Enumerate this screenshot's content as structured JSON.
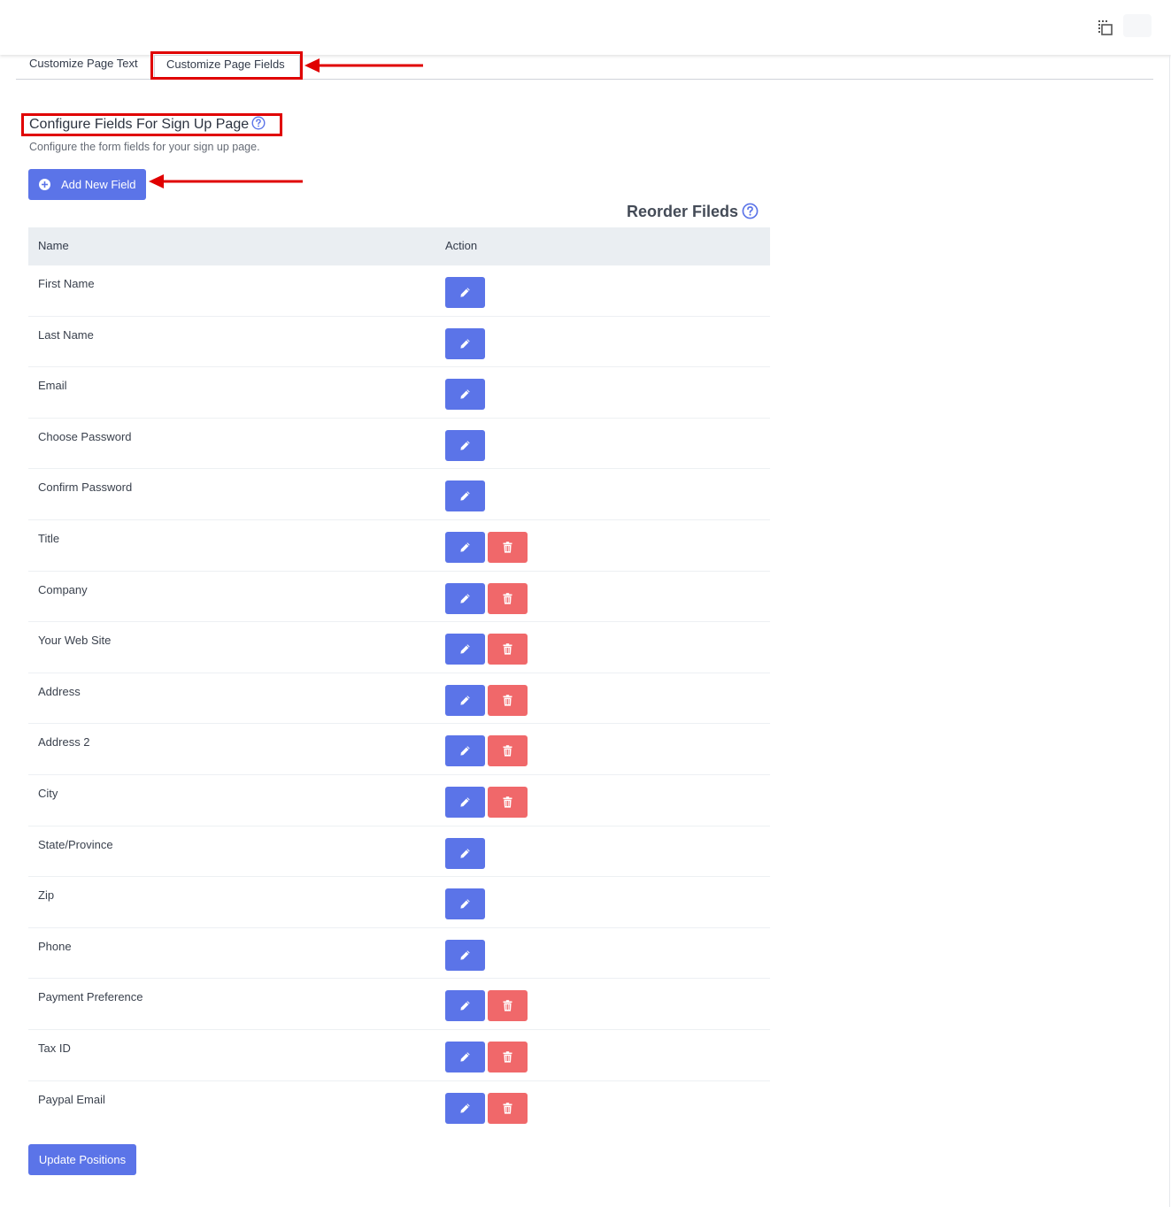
{
  "header": {
    "tool_icon": "selection-copy-icon",
    "avatar_icon": "avatar"
  },
  "tabs": [
    {
      "label": "Customize Page Text",
      "active": false
    },
    {
      "label": "Customize Page Fields",
      "active": true
    }
  ],
  "section": {
    "title": "Configure Fields For Sign Up Page",
    "description": "Configure the form fields for your sign up page.",
    "help_icon": "question-circle-icon"
  },
  "add_button": {
    "label": "Add New Field",
    "icon": "plus-circle-icon"
  },
  "reorder": {
    "label": "Reorder Fileds",
    "icon": "question-circle-icon"
  },
  "table": {
    "columns": [
      "Name",
      "Action"
    ],
    "rows": [
      {
        "name": "First Name",
        "deletable": false
      },
      {
        "name": "Last Name",
        "deletable": false
      },
      {
        "name": "Email",
        "deletable": false
      },
      {
        "name": "Choose Password",
        "deletable": false
      },
      {
        "name": "Confirm Password",
        "deletable": false
      },
      {
        "name": "Title",
        "deletable": true
      },
      {
        "name": "Company",
        "deletable": true
      },
      {
        "name": "Your Web Site",
        "deletable": true
      },
      {
        "name": "Address",
        "deletable": true
      },
      {
        "name": "Address 2",
        "deletable": true
      },
      {
        "name": "City",
        "deletable": true
      },
      {
        "name": "State/Province",
        "deletable": false
      },
      {
        "name": "Zip",
        "deletable": false
      },
      {
        "name": "Phone",
        "deletable": false
      },
      {
        "name": "Payment Preference",
        "deletable": true
      },
      {
        "name": "Tax ID",
        "deletable": true
      },
      {
        "name": "Paypal Email",
        "deletable": true
      }
    ],
    "row_icons": {
      "edit": "pencil-icon",
      "delete": "trash-icon"
    }
  },
  "update_button": {
    "label": "Update Positions"
  },
  "colors": {
    "primary": "#5b74e8",
    "danger": "#f0686a",
    "annotation": "#e00000",
    "header_bg": "#eaeef2"
  }
}
